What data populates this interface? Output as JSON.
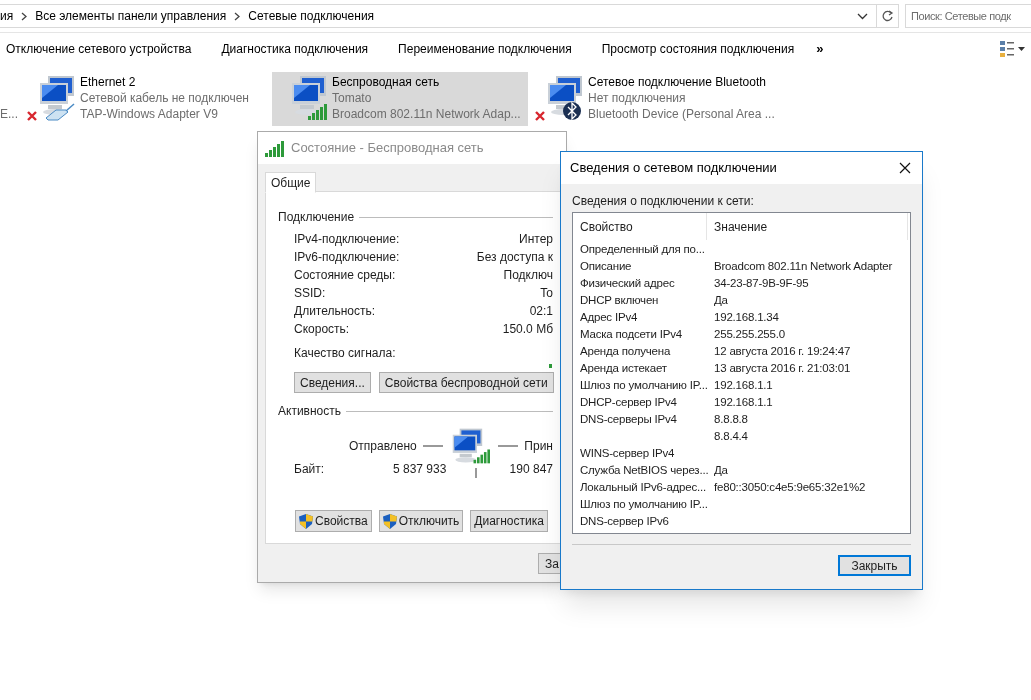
{
  "address_bar": {
    "crumbs": [
      "ия",
      "Все элементы панели управления",
      "Сетевые подключения"
    ],
    "search_placeholder": "Поиск: Сетевые подк"
  },
  "toolbar": {
    "items": [
      "Отключение сетевого устройства",
      "Диагностика подключения",
      "Переименование подключения",
      "Просмотр состояния подключения"
    ],
    "overflow": "»"
  },
  "cut_item_text": "E...",
  "connections": [
    {
      "kind": "ethernet",
      "name": "Ethernet 2",
      "status": "Сетевой кабель не подключен",
      "adapter": "TAP-Windows Adapter V9",
      "selected": false,
      "disconnected": true
    },
    {
      "kind": "wireless",
      "name": "Беспроводная сеть",
      "status": "Tomato",
      "adapter": "Broadcom 802.11n Network Adap...",
      "selected": true,
      "disconnected": false
    },
    {
      "kind": "bluetooth",
      "name": "Сетевое подключение Bluetooth",
      "status": "Нет подключения",
      "adapter": "Bluetooth Device (Personal Area ...",
      "selected": false,
      "disconnected": true
    }
  ],
  "status_dialog": {
    "title": "Состояние - Беспроводная сеть",
    "tabs": [
      {
        "label": "Общие",
        "selected": true
      }
    ],
    "connection_title": "Подключение",
    "rows": [
      {
        "label": "IPv4-подключение:",
        "value": "Интер"
      },
      {
        "label": "IPv6-подключение:",
        "value": "Без доступа к"
      },
      {
        "label": "Состояние среды:",
        "value": "Подключ"
      },
      {
        "label": "SSID:",
        "value": "To"
      },
      {
        "label": "Длительность:",
        "value": "02:1"
      },
      {
        "label": "Скорость:",
        "value": "150.0 Мб"
      }
    ],
    "signal_label": "Качество сигнала:",
    "buttons": [
      "Сведения...",
      "Свойства беспроводной сети"
    ],
    "activity_title": "Активность",
    "sent_label": "Отправлено",
    "received_label": "Прин",
    "bytes_label": "Байт:",
    "bytes_sent": "5 837 933",
    "bytes_received": "190 847",
    "bottom_buttons": [
      {
        "label": "Свойства",
        "shield": true
      },
      {
        "label": "Отключить",
        "shield": true
      },
      {
        "label": "Диагностика",
        "shield": false
      }
    ],
    "close_button": "За"
  },
  "details_dialog": {
    "title": "Сведения о сетевом подключении",
    "caption": "Сведения о подключении к сети:",
    "columns": [
      "Свойство",
      "Значение"
    ],
    "rows": [
      {
        "property": "Определенный для по...",
        "value": ""
      },
      {
        "property": "Описание",
        "value": "Broadcom 802.11n Network Adapter"
      },
      {
        "property": "Физический адрес",
        "value": "34-23-87-9B-9F-95"
      },
      {
        "property": "DHCP включен",
        "value": "Да"
      },
      {
        "property": "Адрес IPv4",
        "value": "192.168.1.34"
      },
      {
        "property": "Маска подсети IPv4",
        "value": "255.255.255.0"
      },
      {
        "property": "Аренда получена",
        "value": "12 августа 2016 г. 19:24:47"
      },
      {
        "property": "Аренда истекает",
        "value": "13 августа 2016 г. 21:03:01"
      },
      {
        "property": "Шлюз по умолчанию IP...",
        "value": "192.168.1.1"
      },
      {
        "property": "DHCP-сервер IPv4",
        "value": "192.168.1.1"
      },
      {
        "property": "DNS-серверы IPv4",
        "value": "8.8.8.8"
      },
      {
        "property": "",
        "value": "8.8.4.4"
      },
      {
        "property": "WINS-сервер IPv4",
        "value": ""
      },
      {
        "property": "Служба NetBIOS через...",
        "value": "Да"
      },
      {
        "property": "Локальный IPv6-адрес...",
        "value": "fe80::3050:c4e5:9e65:32e1%2"
      },
      {
        "property": "Шлюз по умолчанию IP...",
        "value": ""
      },
      {
        "property": "DNS-сервер IPv6",
        "value": ""
      }
    ],
    "close_button": "Закрыть"
  }
}
